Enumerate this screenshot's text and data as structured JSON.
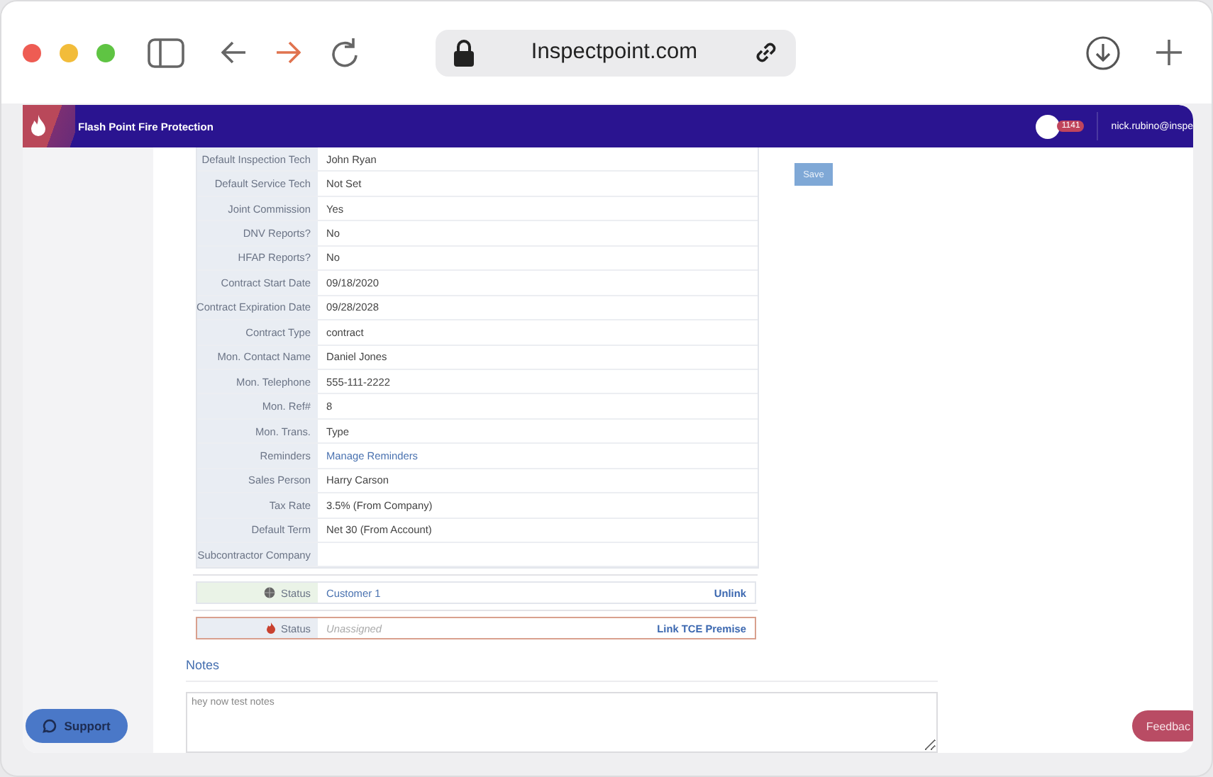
{
  "browser": {
    "url": "Inspectpoint.com"
  },
  "navbar": {
    "company": "Flash Point Fire Protection",
    "badge": "1141",
    "user": "nick.rubino@inspe"
  },
  "save_button": "Save",
  "details": [
    {
      "label": "Default Inspection Tech",
      "value": "John Ryan",
      "kind": "text"
    },
    {
      "label": "Default Service Tech",
      "value": "Not Set",
      "kind": "text"
    },
    {
      "label": "Joint Commission",
      "value": "Yes",
      "kind": "text"
    },
    {
      "label": "DNV Reports?",
      "value": "No",
      "kind": "text"
    },
    {
      "label": "HFAP Reports?",
      "value": "No",
      "kind": "text"
    },
    {
      "label": "Contract Start Date",
      "value": "09/18/2020",
      "kind": "text"
    },
    {
      "label": "Contract Expiration Date",
      "value": "09/28/2028",
      "kind": "text"
    },
    {
      "label": "Contract Type",
      "value": "contract",
      "kind": "text"
    },
    {
      "label": "Mon. Contact Name",
      "value": "Daniel Jones",
      "kind": "text"
    },
    {
      "label": "Mon. Telephone",
      "value": "555-111-2222",
      "kind": "text"
    },
    {
      "label": "Mon. Ref#",
      "value": "8",
      "kind": "text"
    },
    {
      "label": "Mon. Trans.",
      "value": "Type",
      "kind": "text"
    },
    {
      "label": "Reminders",
      "value": "Manage Reminders",
      "kind": "link"
    },
    {
      "label": "Sales Person",
      "value": "Harry Carson",
      "kind": "text"
    },
    {
      "label": "Tax Rate",
      "value": "3.5% (From Company)",
      "kind": "text"
    },
    {
      "label": "Default Term",
      "value": "Net 30 (From Account)",
      "kind": "text"
    },
    {
      "label": "Subcontractor Company",
      "kind": "text"
    }
  ],
  "status_rows": [
    {
      "label": "Status",
      "value": "Customer 1",
      "action": "Unlink",
      "linked": true
    },
    {
      "label": "Status",
      "value": "Unassigned",
      "action": "Link TCE Premise",
      "linked": false
    }
  ],
  "notes": {
    "heading": "Notes",
    "value": "hey now test notes"
  },
  "support_button": "Support",
  "feedback_button": "Feedbac"
}
